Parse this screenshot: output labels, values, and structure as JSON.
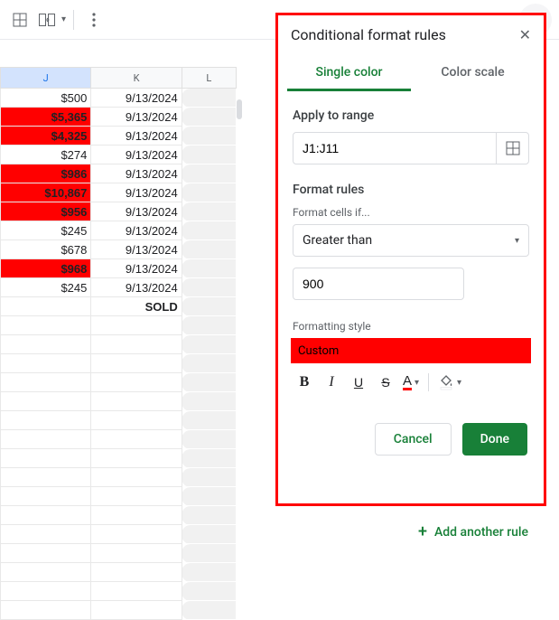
{
  "toolbar_collapsed": true,
  "columns": [
    "J",
    "K",
    "L"
  ],
  "rows": [
    {
      "j": "$500",
      "k": "9/13/2024",
      "hl": false
    },
    {
      "j": "$5,365",
      "k": "9/13/2024",
      "hl": true
    },
    {
      "j": "$4,325",
      "k": "9/13/2024",
      "hl": true
    },
    {
      "j": "$274",
      "k": "9/13/2024",
      "hl": false
    },
    {
      "j": "$986",
      "k": "9/13/2024",
      "hl": true
    },
    {
      "j": "$10,867",
      "k": "9/13/2024",
      "hl": true
    },
    {
      "j": "$956",
      "k": "9/13/2024",
      "hl": true
    },
    {
      "j": "$245",
      "k": "9/13/2024",
      "hl": false
    },
    {
      "j": "$678",
      "k": "9/13/2024",
      "hl": false
    },
    {
      "j": "$968",
      "k": "9/13/2024",
      "hl": true
    },
    {
      "j": "$245",
      "k": "9/13/2024",
      "hl": false
    }
  ],
  "sold_label": "SOLD",
  "panel": {
    "title": "Conditional format rules",
    "tabs": {
      "single": "Single color",
      "scale": "Color scale"
    },
    "apply_label": "Apply to range",
    "range": "J1:J11",
    "format_rules_label": "Format rules",
    "format_cells_if_label": "Format cells if...",
    "condition": "Greater than",
    "value": "900",
    "formatting_style_label": "Formatting style",
    "style_name": "Custom",
    "cancel": "Cancel",
    "done": "Done"
  },
  "add_rule": "Add another rule"
}
